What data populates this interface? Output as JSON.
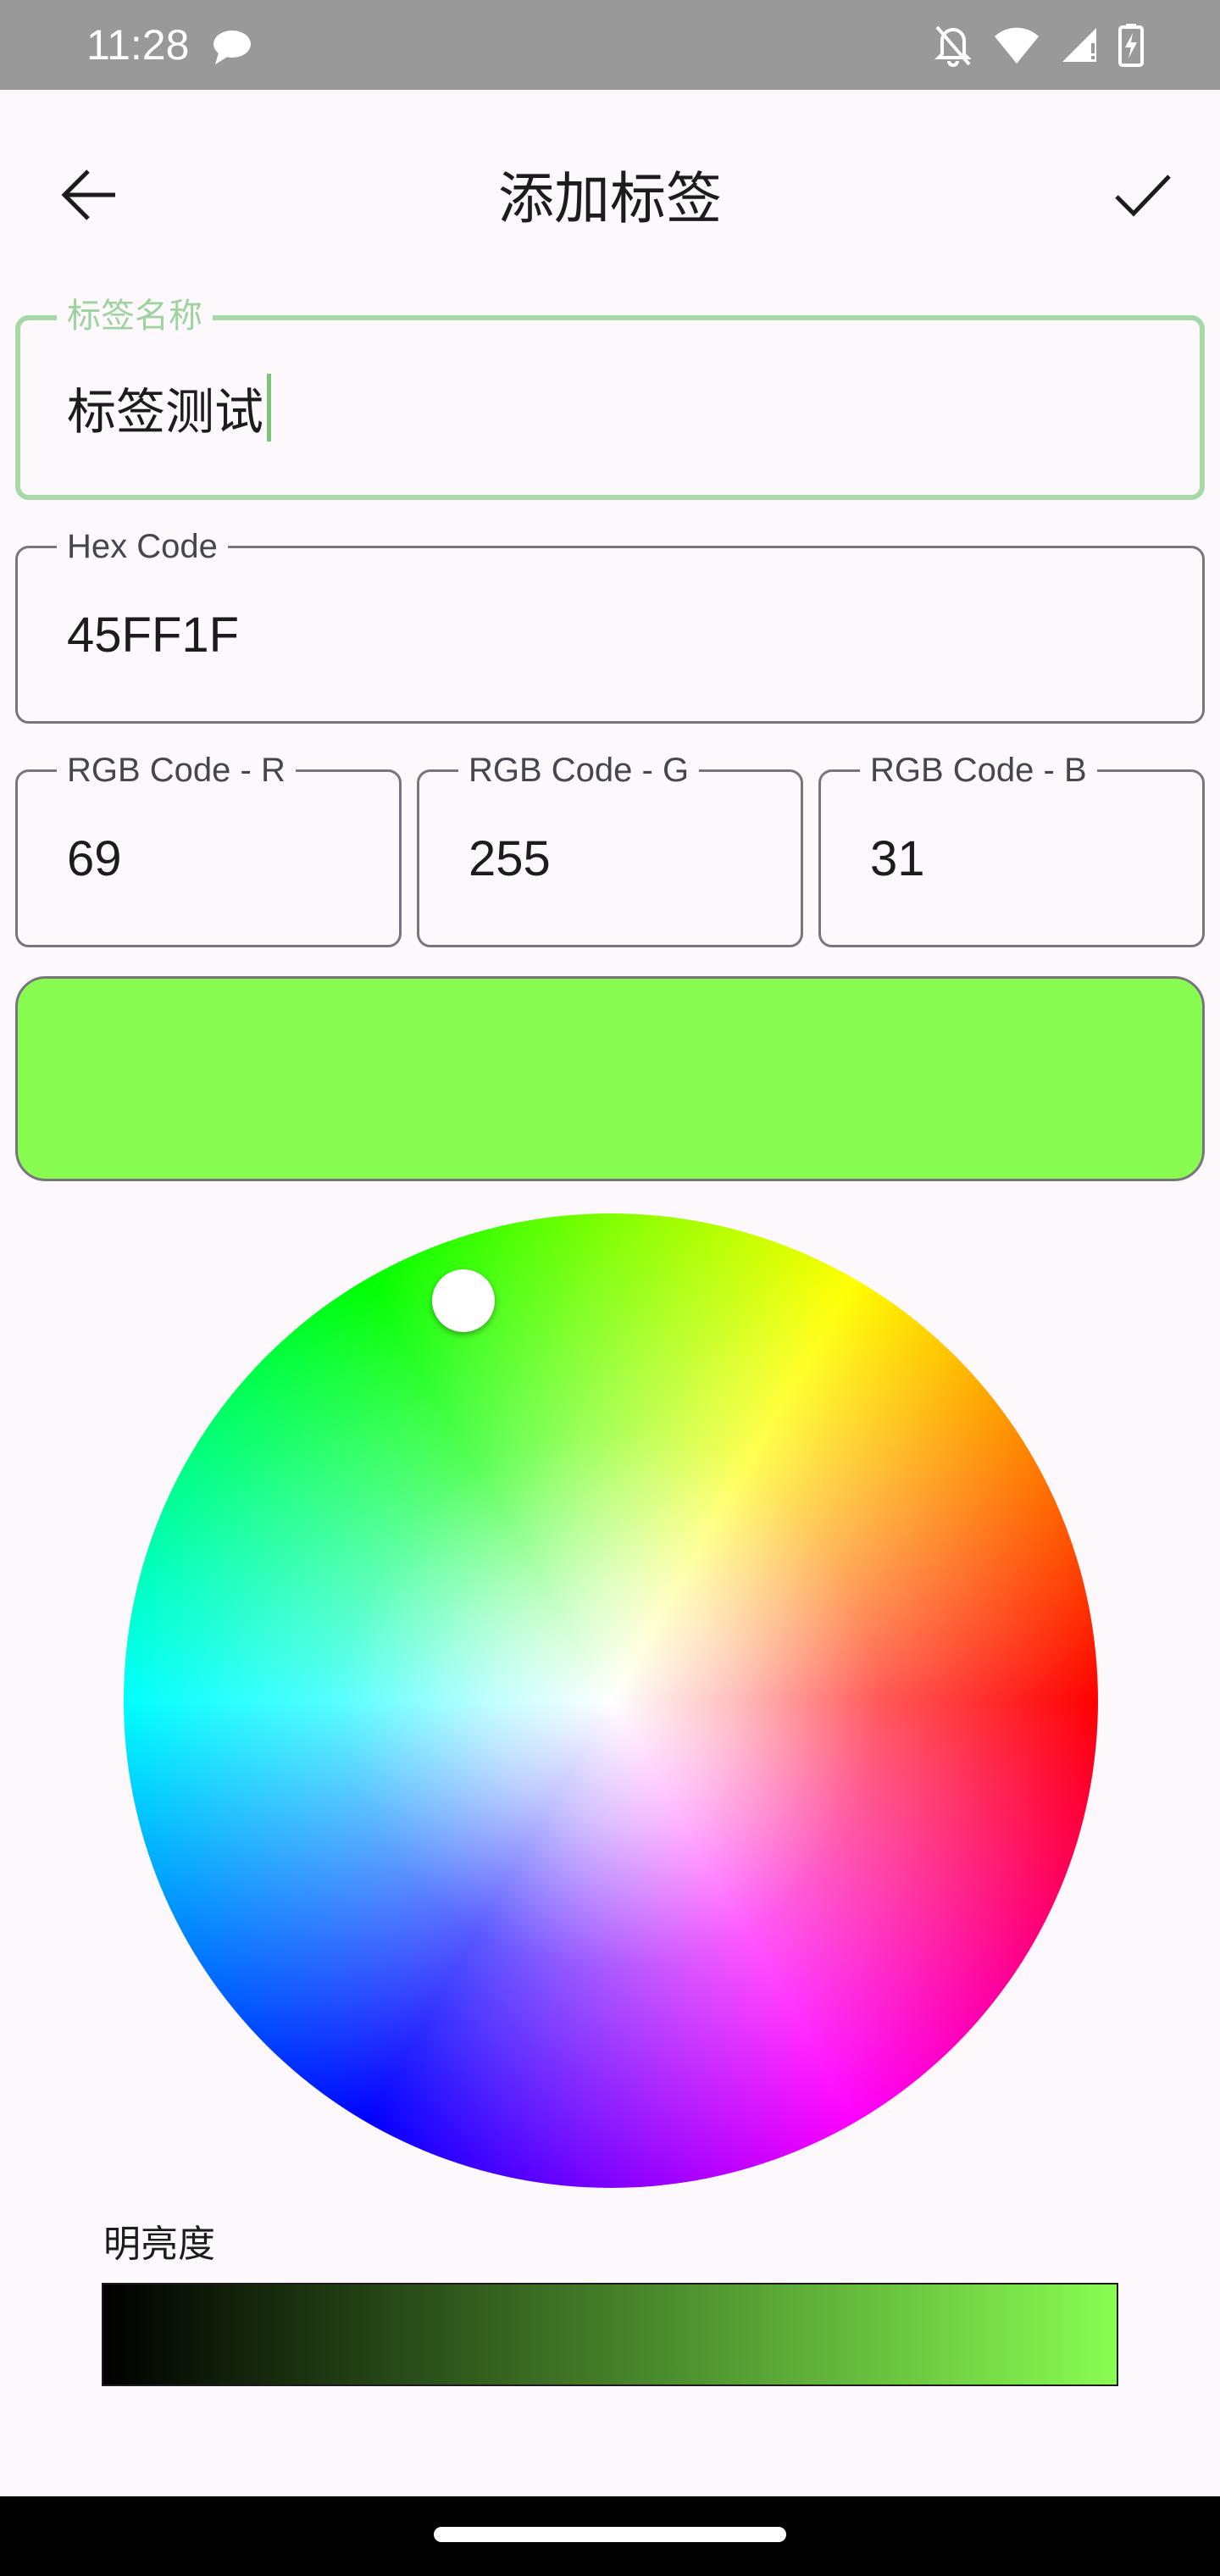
{
  "status_bar": {
    "time": "11:28",
    "icons": [
      "chat-bubble-icon",
      "alarm-off-icon",
      "wifi-icon",
      "signal-icon",
      "battery-charging-icon"
    ]
  },
  "app_bar": {
    "title": "添加标签",
    "back_icon": "arrow-back-icon",
    "confirm_icon": "check-icon"
  },
  "form": {
    "tag_name": {
      "label": "标签名称",
      "value": "标签测试"
    },
    "hex_code": {
      "label": "Hex Code",
      "value": "45FF1F"
    },
    "rgb_r": {
      "label": "RGB Code - R",
      "value": "69"
    },
    "rgb_g": {
      "label": "RGB Code - G",
      "value": "255"
    },
    "rgb_b": {
      "label": "RGB Code - B",
      "value": "31"
    }
  },
  "color_preview": {
    "color": "#89fc52"
  },
  "color_wheel": {
    "type": "hue-saturation-wheel"
  },
  "brightness": {
    "label": "明亮度",
    "from_color": "#000000",
    "to_color": "#89fc52"
  }
}
